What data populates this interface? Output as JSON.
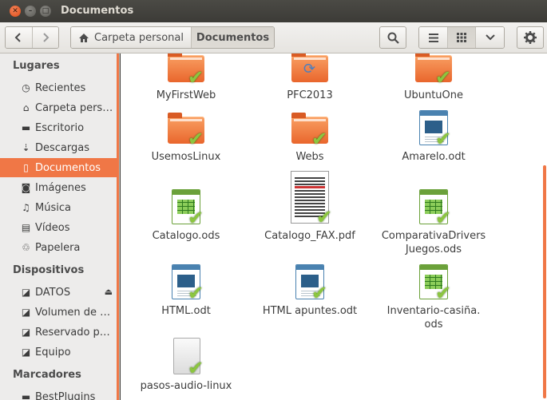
{
  "window": {
    "title": "Documentos"
  },
  "toolbar": {
    "breadcrumbs": [
      {
        "label": "Carpeta personal",
        "icon": "home-icon"
      },
      {
        "label": "Documentos"
      }
    ]
  },
  "sidebar": {
    "sections": [
      {
        "label": "Lugares"
      },
      {
        "label": "Dispositivos"
      },
      {
        "label": "Marcadores"
      }
    ],
    "places": [
      {
        "label": "Recientes",
        "icon": "clock-icon"
      },
      {
        "label": "Carpeta pers…",
        "icon": "home-icon"
      },
      {
        "label": "Escritorio",
        "icon": "desktop-folder-icon"
      },
      {
        "label": "Descargas",
        "icon": "download-icon"
      },
      {
        "label": "Documentos",
        "icon": "document-icon",
        "selected": true
      },
      {
        "label": "Imágenes",
        "icon": "camera-icon"
      },
      {
        "label": "Música",
        "icon": "music-icon"
      },
      {
        "label": "Vídeos",
        "icon": "film-icon"
      },
      {
        "label": "Papelera",
        "icon": "trash-icon"
      }
    ],
    "devices": [
      {
        "label": "DATOS",
        "icon": "drive-icon"
      },
      {
        "label": "Volumen de …",
        "icon": "drive-icon"
      },
      {
        "label": "Reservado p…",
        "icon": "drive-icon"
      },
      {
        "label": "Equipo",
        "icon": "drive-icon"
      }
    ],
    "bookmarks": [
      {
        "label": "BestPlugins",
        "icon": "folder-icon"
      }
    ]
  },
  "files": [
    {
      "name": "MyFirstWeb",
      "type": "folder"
    },
    {
      "name": "PFC2013",
      "type": "folder-sync"
    },
    {
      "name": "UbuntuOne",
      "type": "folder"
    },
    {
      "name": "UsemosLinux",
      "type": "folder"
    },
    {
      "name": "Webs",
      "type": "folder"
    },
    {
      "name": "Amarelo.odt",
      "type": "odt"
    },
    {
      "name": "Catalogo.ods",
      "type": "ods"
    },
    {
      "name": "Catalogo_FAX.pdf",
      "type": "pdf"
    },
    {
      "name": "ComparativaDrivers\nJuegos.ods",
      "type": "ods"
    },
    {
      "name": "HTML.odt",
      "type": "odt"
    },
    {
      "name": "HTML apuntes.odt",
      "type": "odt"
    },
    {
      "name": "Inventario-casiña.\nods",
      "type": "ods"
    },
    {
      "name": "pasos-audio-linux",
      "type": "text"
    }
  ],
  "colors": {
    "accent": "#f07746",
    "check": "#8cc63f"
  }
}
